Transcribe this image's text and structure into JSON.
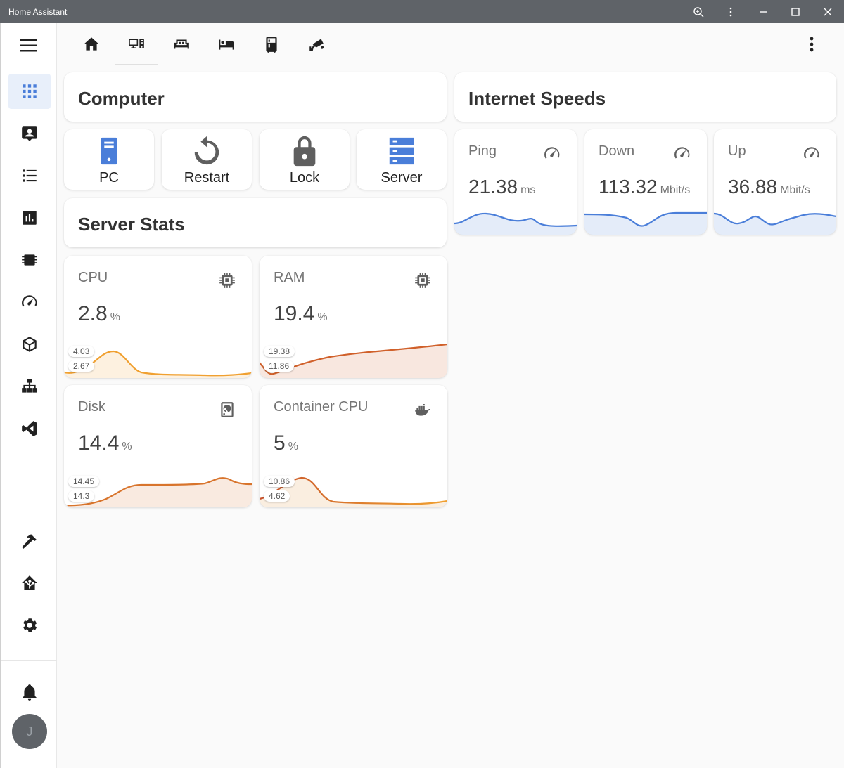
{
  "window": {
    "title": "Home Assistant",
    "controls": [
      "zoom-icon",
      "more-vert-icon",
      "minimize-icon",
      "maximize-icon",
      "close-icon"
    ]
  },
  "sidebar": {
    "items": [
      {
        "name": "overview",
        "icon": "view-grid-icon",
        "active": true
      },
      {
        "name": "map",
        "icon": "account-box-icon"
      },
      {
        "name": "logbook",
        "icon": "list-icon"
      },
      {
        "name": "history",
        "icon": "chart-box-icon"
      },
      {
        "name": "hardware",
        "icon": "chip-icon"
      },
      {
        "name": "speedtest",
        "icon": "speedometer-icon"
      },
      {
        "name": "hacs",
        "icon": "package-icon"
      },
      {
        "name": "network",
        "icon": "sitemap-icon"
      },
      {
        "name": "vscode",
        "icon": "visual-studio-code-icon"
      },
      {
        "name": "developer-tools",
        "icon": "hammer-icon"
      },
      {
        "name": "supervisor",
        "icon": "home-assistant-icon"
      },
      {
        "name": "settings",
        "icon": "cog-icon"
      }
    ],
    "notifications_icon": "bell-icon",
    "avatar_initial": "J"
  },
  "toolbar": {
    "views": [
      {
        "name": "home",
        "icon": "home-icon"
      },
      {
        "name": "computer",
        "icon": "monitor-desktop-icon",
        "active": true
      },
      {
        "name": "living-room",
        "icon": "sofa-icon"
      },
      {
        "name": "bedroom",
        "icon": "bed-icon"
      },
      {
        "name": "kitchen",
        "icon": "fridge-icon"
      },
      {
        "name": "security",
        "icon": "cctv-icon"
      }
    ],
    "more_icon": "dots-vertical-icon"
  },
  "computer": {
    "title": "Computer",
    "buttons": [
      {
        "label": "PC",
        "icon": "desktop-tower-icon",
        "color": "#4a7ed9"
      },
      {
        "label": "Restart",
        "icon": "restart-icon",
        "color": "#5f5f5f"
      },
      {
        "label": "Lock",
        "icon": "lock-icon",
        "color": "#5f5f5f"
      },
      {
        "label": "Server",
        "icon": "server-icon",
        "color": "#4a7ed9"
      }
    ]
  },
  "server_stats": {
    "title": "Server Stats",
    "sensors": [
      {
        "name": "CPU",
        "value": "2.8",
        "unit": "%",
        "icon": "chip-icon",
        "max": "4.03",
        "min": "2.67",
        "color": "#f0a030"
      },
      {
        "name": "RAM",
        "value": "19.4",
        "unit": "%",
        "icon": "chip-icon",
        "max": "19.38",
        "min": "11.86",
        "color": "#d0602a"
      },
      {
        "name": "Disk",
        "value": "14.4",
        "unit": "%",
        "icon": "harddisk-icon",
        "max": "14.45",
        "min": "14.3",
        "color": "#d8742c"
      },
      {
        "name": "Container CPU",
        "value": "5",
        "unit": "%",
        "icon": "docker-icon",
        "max": "10.86",
        "min": "4.62",
        "color": "#e0902c"
      }
    ]
  },
  "internet": {
    "title": "Internet Speeds",
    "sensors": [
      {
        "name": "Ping",
        "value": "21.38",
        "unit": "ms",
        "icon": "speedometer-icon",
        "color": "#4a7ed9"
      },
      {
        "name": "Down",
        "value": "113.32",
        "unit": "Mbit/s",
        "icon": "speedometer-icon",
        "color": "#4a7ed9"
      },
      {
        "name": "Up",
        "value": "36.88",
        "unit": "Mbit/s",
        "icon": "speedometer-icon",
        "color": "#4a7ed9"
      }
    ]
  }
}
